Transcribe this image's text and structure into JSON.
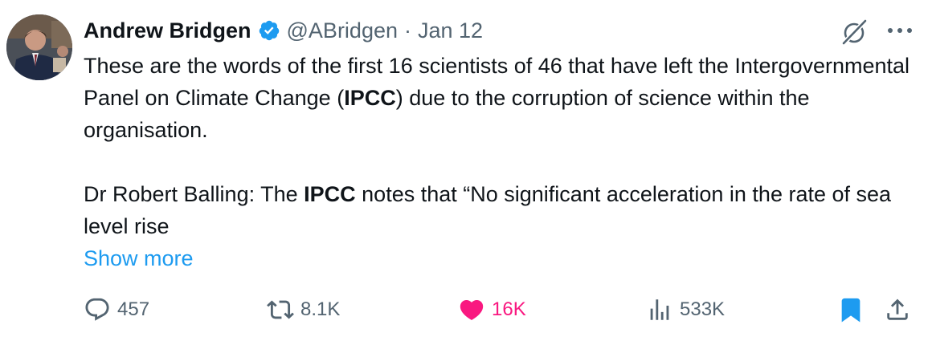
{
  "author": {
    "name": "Andrew Bridgen",
    "handle": "@ABridgen",
    "separator": "·",
    "date": "Jan 12",
    "verified": true
  },
  "tweet": {
    "paragraph1": {
      "pre": "These are the words of the first 16 scientists of 46 that have left the Intergovernmental Panel on Climate Change (",
      "bold": "IPCC",
      "post": ") due to the corruption of science within the organisation."
    },
    "paragraph2": {
      "pre": "Dr Robert Balling: The ",
      "bold": "IPCC",
      "post": " notes that “No significant acceleration in the rate of sea level rise"
    },
    "show_more": "Show more"
  },
  "actions": {
    "replies": "457",
    "reposts": "8.1K",
    "likes": "16K",
    "views": "533K"
  },
  "icons": {
    "verified": "verified-badge-icon",
    "grok": "grok-icon",
    "more": "more-options-icon",
    "reply": "reply-icon",
    "repost": "repost-icon",
    "like": "heart-icon",
    "views": "views-icon",
    "bookmark": "bookmark-icon",
    "share": "share-icon"
  },
  "colors": {
    "text": "#0f1419",
    "secondary": "#536471",
    "link": "#1d9bf0",
    "like": "#f91880",
    "verified": "#1d9bf0"
  }
}
